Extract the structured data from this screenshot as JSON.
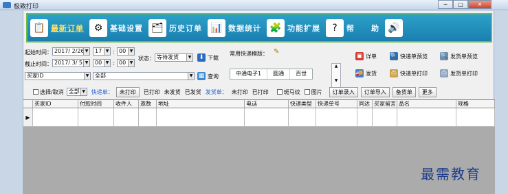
{
  "window": {
    "title": "极致打印",
    "minimize": "─",
    "maximize": "□",
    "close": "✕"
  },
  "nav": {
    "items": [
      {
        "label": "最新订单",
        "icon": "latest-orders-icon",
        "glyph": "📋",
        "active": true
      },
      {
        "label": "基础设置",
        "icon": "settings-gear-icon",
        "glyph": "⚙",
        "active": false
      },
      {
        "label": "历史订单",
        "icon": "history-orders-icon",
        "glyph": "🗂",
        "active": false
      },
      {
        "label": "数据统计",
        "icon": "statistics-chart-icon",
        "glyph": "📊",
        "active": false
      },
      {
        "label": "功能扩展",
        "icon": "extension-icon",
        "glyph": "🧩",
        "active": false
      },
      {
        "label": "帮　　助",
        "icon": "help-icon",
        "glyph": "?",
        "active": false
      },
      {
        "label": "",
        "icon": "announcement-icon",
        "glyph": "🔊",
        "active": false
      }
    ]
  },
  "filters": {
    "start_label": "起始时间：",
    "start_date": "2017/ 2/26",
    "start_hour": "17",
    "start_min": "00",
    "end_label": "截止时间：",
    "end_date": "2017/ 3/ 5",
    "end_hour": "00",
    "end_min": "00",
    "colon": ":",
    "status_label": "状态：",
    "status_value": "等待发货",
    "download_label": "下载",
    "query_label": "查询",
    "buyer_field": "买家ID",
    "buyer_scope": "全部",
    "templates_label": "常用快递模版：",
    "templates": [
      "中通电子1",
      "圆通",
      "百世"
    ],
    "detail_label": "详单",
    "ship_label": "发货",
    "express_preview": "快递单预览",
    "express_print": "快递单打印",
    "delivery_preview": "发货单预览",
    "delivery_print": "发货单打印"
  },
  "toolbar": {
    "select_toggle": "选择/取消",
    "scope": "全部",
    "express_label": "快递单：",
    "express_opts": [
      "未打印",
      "已打印",
      "未发货",
      "已发货"
    ],
    "delivery_label": "发货单：",
    "delivery_opts": [
      "未打印",
      "已打印"
    ],
    "zebra": "斑马纹",
    "image": "图片",
    "actions": [
      "订单录入",
      "订单导入",
      "备货单",
      "更多"
    ]
  },
  "table": {
    "columns": [
      "",
      "买家ID",
      "付款时间",
      "收件人",
      "邀数",
      "地址",
      "电话",
      "快递类型",
      "快递单号",
      "同达",
      "买家留言",
      "品名",
      "规格"
    ],
    "row_marker": "▶"
  },
  "watermark": "最需教育",
  "colors": {
    "nav_bg": "#1a7fb0",
    "nav_border": "#6cbd4a",
    "active_nav": "#ffe26a"
  }
}
